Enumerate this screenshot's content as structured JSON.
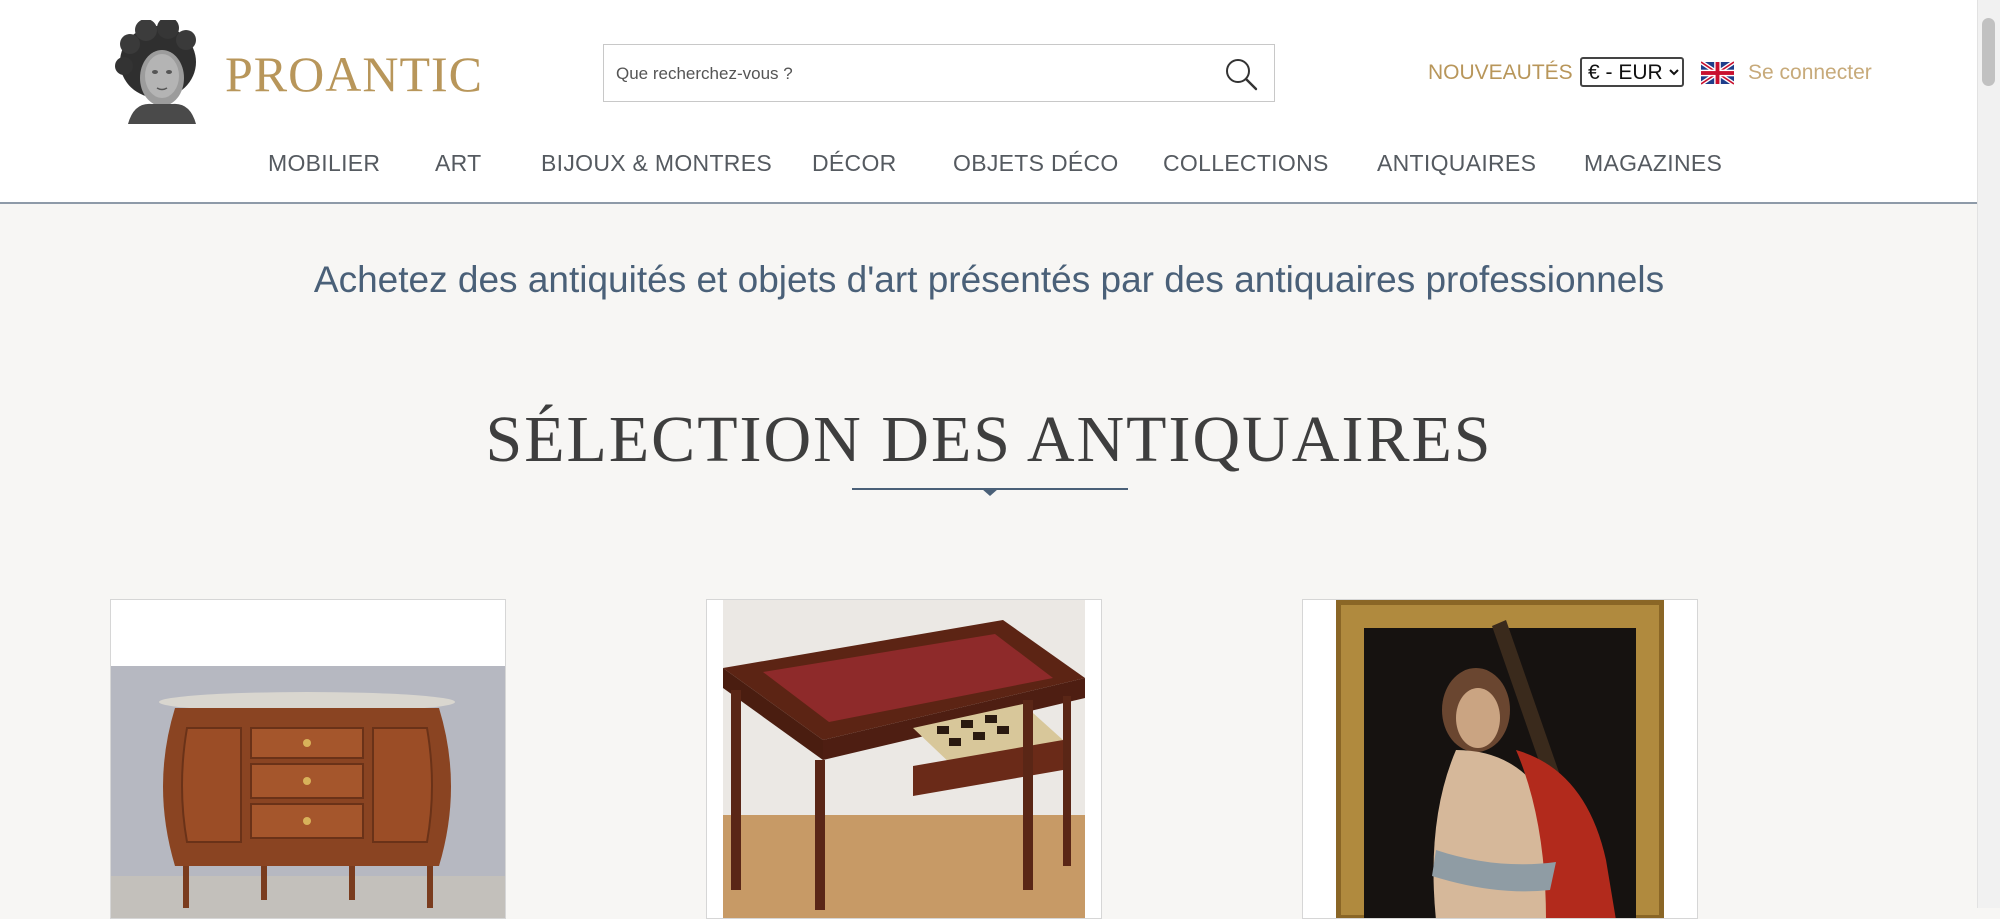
{
  "header": {
    "logo_text": "PROANTIC",
    "search": {
      "placeholder": "Que recherchez-vous ?",
      "value": ""
    },
    "nouveautes_label": "NOUVEAUTÉS",
    "currency": {
      "selected": "€ - EUR"
    },
    "language_icon": "uk-flag-icon",
    "login_label": "Se connecter",
    "nav": [
      "MOBILIER",
      "ART",
      "BIJOUX & MONTRES",
      "DÉCOR",
      "OBJETS DÉCO",
      "COLLECTIONS",
      "ANTIQUAIRES",
      "MAGAZINES"
    ]
  },
  "main": {
    "tagline": "Achetez des antiquités et objets d'art présentés par des antiquaires professionnels",
    "section_title": "SÉLECTION DES ANTIQUAIRES",
    "cards": [
      {
        "image": "demi-lune-commode"
      },
      {
        "image": "mahogany-writing-desk-with-games-drawer"
      },
      {
        "image": "christ-carrying-cross-painting"
      }
    ]
  },
  "colors": {
    "brand_gold": "#b8965a",
    "login_gold": "#c7aa7a",
    "tagline_blue": "#4a6078",
    "page_background": "#f7f6f4"
  }
}
